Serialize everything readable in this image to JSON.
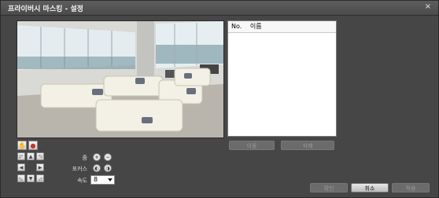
{
  "dialog": {
    "title": "프라이버시 마스킹 - 설정",
    "close_label": "×"
  },
  "list": {
    "columns": [
      "No.",
      "이름"
    ]
  },
  "list_buttons": {
    "add_label": "이동",
    "delete_label": "삭제"
  },
  "ptz": {
    "zoom_label": "줌",
    "focus_label": "포커스",
    "speed_label": "속도",
    "speed_value": "8"
  },
  "footer": {
    "ok_label": "확인",
    "cancel_label": "취소",
    "apply_label": "적용"
  }
}
